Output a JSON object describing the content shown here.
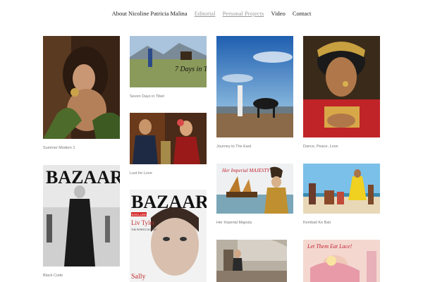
{
  "nav": {
    "about": "About Nicoline Patricia Malina",
    "editorial": "Editorial",
    "personal": "Personal Projects",
    "video": "Video",
    "contact": "Contact"
  },
  "gallery": {
    "captions": [
      "Summer Modern 1",
      "Seven Days in Tibet",
      "Journey to The East",
      "Dance, Peace, Love",
      "Lust for Love",
      "Black Code",
      "Her Imperial Majesty",
      "Kembali Ke Bali"
    ],
    "overlay_text": {
      "tibet": "7 Days in Tibet",
      "bazaar1": "BAZAAR",
      "bazaar2": "BAZAAR",
      "bazaar2_badge": "EXCLUSIVE",
      "bazaar2_name": "Liv Tyler",
      "bazaar2_small": "THE PERFECTIONIST",
      "bazaar2_bottom": "Sally",
      "imperial": "Her Imperial MAJESTY",
      "letthemeat": "Let Them Eat Lace!"
    }
  },
  "colors": {
    "nav_text": "#222222",
    "nav_muted": "#9a9a9a",
    "caption": "#777777"
  }
}
